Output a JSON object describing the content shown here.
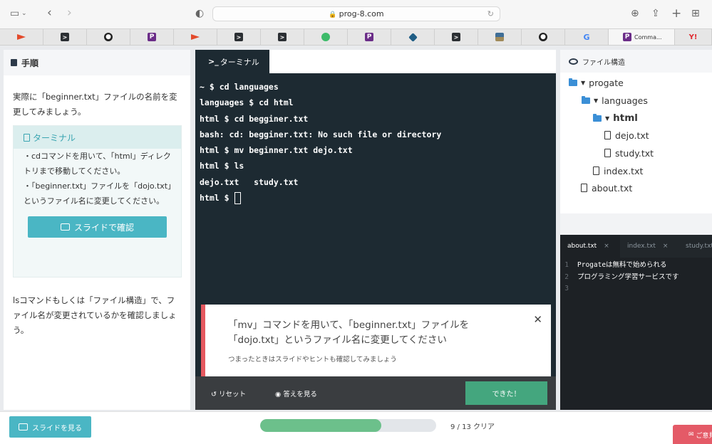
{
  "browser": {
    "url": "prog-8.com",
    "active_tab_title": "Comma...",
    "tabs": [
      {
        "icon": "red-flag-icon"
      },
      {
        "icon": "terminal-icon"
      },
      {
        "icon": "github-icon"
      },
      {
        "icon": "progate-icon"
      },
      {
        "icon": "red-flag-icon"
      },
      {
        "icon": "terminal-icon"
      },
      {
        "icon": "terminal-icon"
      },
      {
        "icon": "green-circle-icon"
      },
      {
        "icon": "progate-icon"
      },
      {
        "icon": "diamond-icon"
      },
      {
        "icon": "terminal-icon"
      },
      {
        "icon": "image-icon"
      },
      {
        "icon": "github-icon"
      },
      {
        "icon": "google-icon"
      }
    ]
  },
  "left": {
    "heading": "手順",
    "intro": "実際に「beginner.txt」ファイルの名前を変更してみましょう。",
    "box_title": "ターミナル",
    "bullets": [
      "・cdコマンドを用いて、「html」ディレクトリまで移動してください。",
      "・「beginner.txt」ファイルを「dojo.txt」というファイル名に変更してください。"
    ],
    "slide_button": "スライドで確認",
    "outro": "lsコマンドもしくは「ファイル構造」で、ファイル名が変更されているかを確認しましょう。"
  },
  "terminal": {
    "tab_prompt": ">_",
    "tab_label": "ターミナル",
    "lines": [
      "~ $ cd languages",
      "languages $ cd html",
      "html $ cd begginer.txt",
      "bash: cd: begginer.txt: No such file or directory",
      "html $ mv beginner.txt dejo.txt",
      "html $ ls",
      "dejo.txt   study.txt"
    ],
    "prompt": "html $ ",
    "task_main_line1": "「mv」コマンドを用いて、「beginner.txt」ファイルを",
    "task_main_line2": "「dojo.txt」というファイル名に変更してください",
    "task_sub": "つまったときはスライドやヒントも確認してみましょう",
    "task_close": "✕",
    "reset": "リセット",
    "answer": "答えを見る",
    "done": "できた！"
  },
  "file_tree": {
    "heading": "ファイル構造",
    "items": [
      {
        "name": "progate",
        "type": "folder"
      },
      {
        "name": "languages",
        "type": "folder"
      },
      {
        "name": "html",
        "type": "folder"
      },
      {
        "name": "dejo.txt",
        "type": "file"
      },
      {
        "name": "study.txt",
        "type": "file"
      },
      {
        "name": "index.txt",
        "type": "file"
      },
      {
        "name": "about.txt",
        "type": "file"
      }
    ]
  },
  "editor": {
    "tabs": [
      "about.txt",
      "index.txt",
      "study.txt"
    ],
    "close": "×",
    "lines": [
      {
        "num": "1",
        "text": "Progateは無料で始められる"
      },
      {
        "num": "2",
        "text": "プログラミング学習サービスです"
      },
      {
        "num": "3",
        "text": ""
      }
    ]
  },
  "bottom": {
    "slide_button": "スライドを見る",
    "progress_fraction": 0.69,
    "progress_label": "9 / 13 クリア",
    "contact": "ご意見"
  },
  "colors": {
    "accent_teal": "#4ab6c4",
    "done_green": "#44a67e",
    "task_red": "#e5585f",
    "progress_green": "#6cc08b"
  }
}
